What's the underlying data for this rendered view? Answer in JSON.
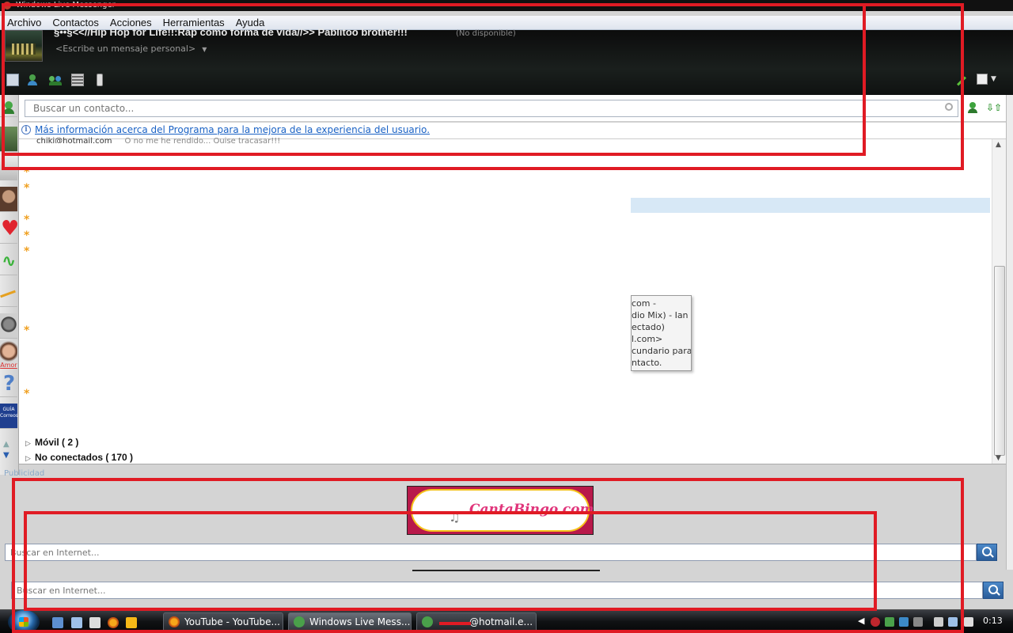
{
  "window": {
    "title": "Windows Live Messenger"
  },
  "menu": [
    "Archivo",
    "Contactos",
    "Acciones",
    "Herramientas",
    "Ayuda"
  ],
  "profile": {
    "display_name": "§••§<<//Hip Hop for Life!!:Rap como forma de vida//>> Pablitoo brother!!!",
    "status": "(No disponible)",
    "personal_message": "<Escribe un mensaje personal>"
  },
  "toolbar": {
    "icons": [
      "mail-icon",
      "contacts-icon",
      "group-icon",
      "games-icon",
      "mobile-icon",
      "pencil-icon",
      "options-icon"
    ]
  },
  "search": {
    "placeholder": "Buscar un contacto..."
  },
  "info_bar": {
    "text": "Más información acerca del Programa para la mejora de la experiencia del usuario."
  },
  "contacts": {
    "partial_row": {
      "email": "chiki@hotmail.com",
      "message": "O no me he rendido... Quise tracasar!!!"
    },
    "tooltip_lines": [
      "com -",
      "dio Mix) - Ian",
      "ectado)",
      "l.com>",
      "cundario para",
      "ntacto."
    ],
    "groups": [
      {
        "label": "Móvil ( 2 )"
      },
      {
        "label": "No conectados ( 170 )"
      }
    ],
    "star_color": "#f0a020"
  },
  "ad": {
    "label": "Publicidad",
    "banner_text": "CantaBingo.com"
  },
  "web_search": {
    "placeholder": "Buscar en Internet..."
  },
  "taskbar": {
    "buttons": [
      {
        "label": "YouTube - YouTube..."
      },
      {
        "label": "Windows Live Mess..."
      },
      {
        "label": "@hotmail.e..."
      }
    ],
    "clock": "0:13"
  },
  "colors": {
    "accent": "#1a62c5",
    "annotation": "#e01b24",
    "header": "#0f1211"
  }
}
